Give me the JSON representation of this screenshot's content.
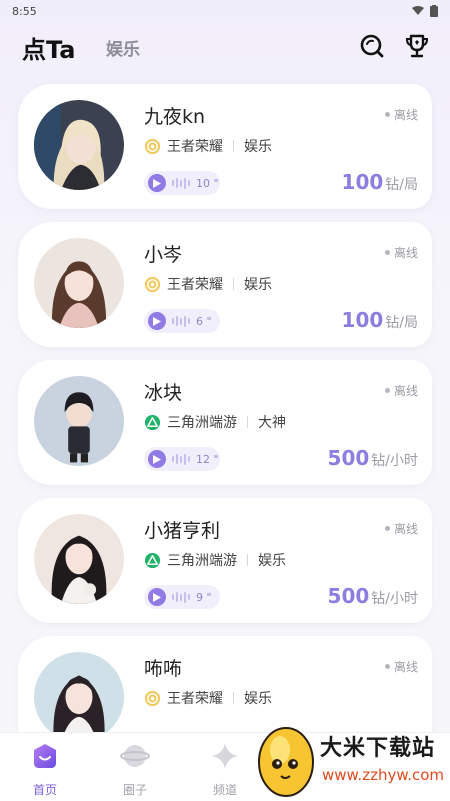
{
  "status_bar": {
    "time": "8:55"
  },
  "header": {
    "title": "点Ta",
    "tab_secondary": "娱乐"
  },
  "cards": [
    {
      "name": "九夜kn",
      "status": "离线",
      "game": "王者荣耀",
      "game_icon": "honor-of-kings-icon",
      "category": "娱乐",
      "voice": "10 \"",
      "price": "100",
      "unit": "钻/局"
    },
    {
      "name": "小岑",
      "status": "离线",
      "game": "王者荣耀",
      "game_icon": "honor-of-kings-icon",
      "category": "娱乐",
      "voice": "6 \"",
      "price": "100",
      "unit": "钻/局"
    },
    {
      "name": "冰块",
      "status": "离线",
      "game": "三角洲端游",
      "game_icon": "delta-force-icon",
      "category": "大神",
      "voice": "12 \"",
      "price": "500",
      "unit": "钻/小时"
    },
    {
      "name": "小猪亨利",
      "status": "离线",
      "game": "三角洲端游",
      "game_icon": "delta-force-icon",
      "category": "娱乐",
      "voice": "9 \"",
      "price": "500",
      "unit": "钻/小时"
    },
    {
      "name": "咘咘",
      "status": "离线",
      "game": "王者荣耀",
      "game_icon": "honor-of-kings-icon",
      "category": "娱乐"
    }
  ],
  "tabbar": {
    "items": [
      "首页",
      "圈子",
      "频道"
    ]
  },
  "watermark": {
    "title": "大米下载站",
    "url": "www.zzhyw.com"
  },
  "colors": {
    "accent": "#8c7ee0",
    "active_tab": "#7e5ee0",
    "gold": "#e8b640",
    "green": "#1fb36a"
  }
}
